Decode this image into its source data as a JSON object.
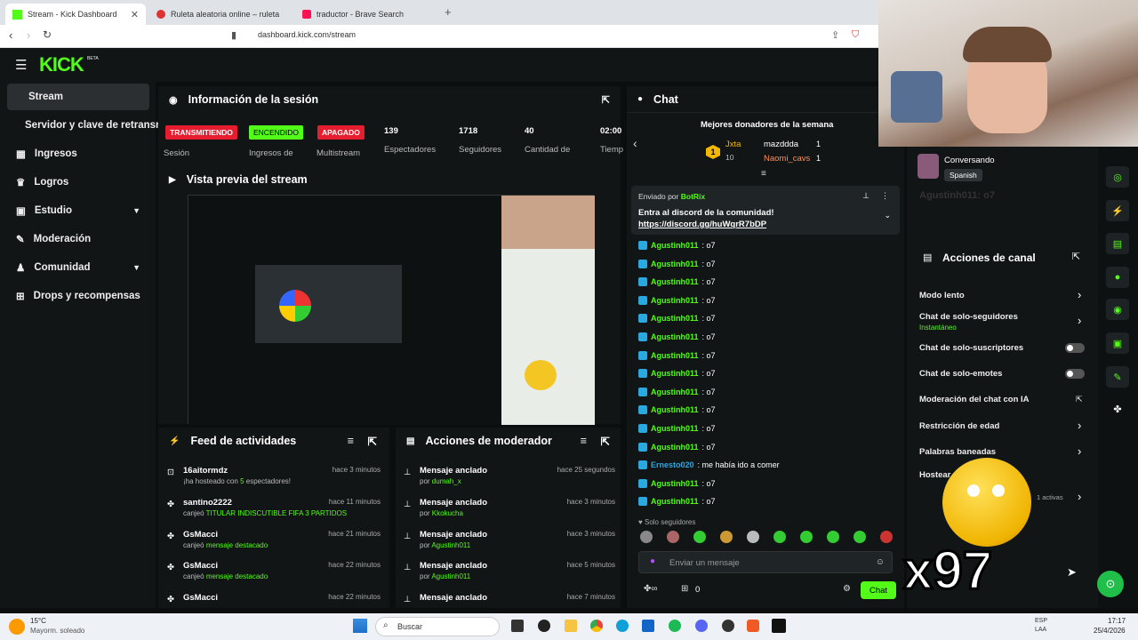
{
  "tabs": [
    {
      "label": "Stream - Kick Dashboard"
    },
    {
      "label": "Ruleta aleatoria online – ruleta de la"
    },
    {
      "label": "traductor - Brave Search"
    }
  ],
  "url": "dashboard.kick.com/stream",
  "nav": {
    "logo": "KICK",
    "beta": "BETA",
    "items": [
      "Stream",
      "Servidor y clave de retransn",
      "Ingresos",
      "Logros",
      "Estudio",
      "Moderación",
      "Comunidad",
      "Drops y recompensas"
    ]
  },
  "session": {
    "title": "Información de la sesión",
    "stats": [
      {
        "badge": "TRANSMITIENDO",
        "label": "Sesión"
      },
      {
        "badge": "ENCENDIDO",
        "label": "Ingresos de"
      },
      {
        "badge": "APAGADO",
        "label": "Multistream"
      },
      {
        "value": "139",
        "label": "Espectadores"
      },
      {
        "value": "1718",
        "label": "Seguidores"
      },
      {
        "value": "40",
        "label": "Cantidad de"
      },
      {
        "value": "02:00",
        "label": "Tiemp"
      }
    ]
  },
  "preview": {
    "title": "Vista previa del stream"
  },
  "feed": {
    "title": "Feed de actividades",
    "items": [
      {
        "name": "16aitormdz",
        "time": "hace 3 minutos",
        "pre": "¡ha hosteado con",
        "hl": "5",
        "post": "espectadores!"
      },
      {
        "name": "santino2222",
        "time": "hace 11 minutos",
        "pre": "canjeó",
        "hl": "TITULAR INDISCUTIBLE FIFA 3 PARTIDOS",
        "post": ""
      },
      {
        "name": "GsMacci",
        "time": "hace 21 minutos",
        "pre": "canjeó",
        "hl": "mensaje destacado",
        "post": ""
      },
      {
        "name": "GsMacci",
        "time": "hace 22 minutos",
        "pre": "canjeó",
        "hl": "mensaje destacado",
        "post": ""
      },
      {
        "name": "GsMacci",
        "time": "hace 22 minutos",
        "pre": "",
        "hl": "",
        "post": ""
      }
    ]
  },
  "mod": {
    "title": "Acciones de moderador",
    "items": [
      {
        "action": "Mensaje anclado",
        "by": "dumah_x",
        "time": "hace 25 segundos"
      },
      {
        "action": "Mensaje anclado",
        "by": "Kkokucha",
        "time": "hace 3 minutos"
      },
      {
        "action": "Mensaje anclado",
        "by": "Agustinh011",
        "time": "hace 3 minutos"
      },
      {
        "action": "Mensaje anclado",
        "by": "Agustinh011",
        "time": "hace 5 minutos"
      },
      {
        "action": "Mensaje anclado",
        "by": "",
        "time": "hace 7 minutos"
      }
    ]
  },
  "chat": {
    "title": "Chat",
    "donors_title": "Mejores donadores de la semana",
    "donors": [
      {
        "name": "Jxta",
        "amount": "10"
      },
      {
        "name": "mazddda",
        "amount": "1"
      },
      {
        "name": "Naomi_cavs",
        "amount": "1"
      }
    ],
    "pinned_by_label": "Enviado por",
    "pinned_by": "BotRix",
    "pinned_text": "Entra al discord de la comunidad!",
    "pinned_link": "https://discord.gg/huWqrR7bDP",
    "messages": [
      {
        "user": "Agustinh011",
        "text": ": o7"
      },
      {
        "user": "Agustinh011",
        "text": ": o7"
      },
      {
        "user": "Agustinh011",
        "text": ": o7"
      },
      {
        "user": "Agustinh011",
        "text": ": o7"
      },
      {
        "user": "Agustinh011",
        "text": ": o7"
      },
      {
        "user": "Agustinh011",
        "text": ": o7"
      },
      {
        "user": "Agustinh011",
        "text": ": o7"
      },
      {
        "user": "Agustinh011",
        "text": ": o7"
      },
      {
        "user": "Agustinh011",
        "text": ": o7"
      },
      {
        "user": "Agustinh011",
        "text": ": o7"
      },
      {
        "user": "Agustinh011",
        "text": ": o7"
      },
      {
        "user": "Agustinh011",
        "text": ": o7"
      },
      {
        "user": "Ernesto020",
        "text": ": me había ido a comer"
      },
      {
        "user": "Agustinh011",
        "text": ": o7"
      },
      {
        "user": "Agustinh011",
        "text": ": o7"
      }
    ],
    "followers_only": "Solo seguidores",
    "placeholder": "Enviar un mensaje",
    "count": "0",
    "send": "Chat"
  },
  "actions": {
    "title": "Acciones de canal",
    "items": [
      "Modo lento",
      "Chat de solo-seguidores",
      "Chat de solo-suscriptores",
      "Chat de solo-emotes",
      "Moderación del chat con IA",
      "Restricción de edad",
      "Palabras baneadas",
      "Hostear"
    ],
    "sub": "Instantáneo",
    "active": "1 activas"
  },
  "overlay": {
    "status": "Conversando",
    "lang": "Spanish",
    "ghost": "Agustinh011: o7",
    "combo": "x97"
  },
  "taskbar": {
    "temp": "15°C",
    "weather": "Mayorm. soleado",
    "search": "Buscar",
    "lang1": "ESP",
    "lang2": "LAA",
    "time": "17:17",
    "date": "25/4/2026"
  }
}
